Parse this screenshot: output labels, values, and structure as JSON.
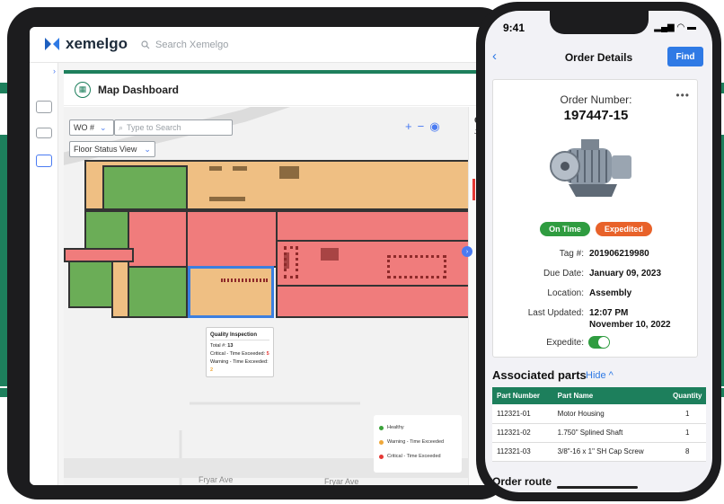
{
  "brand": {
    "name": "xemelgo",
    "green": "#1d7f5c",
    "blue": "#2f7ae5"
  },
  "tablet": {
    "search_placeholder": "Search Xemelgo",
    "dashboard_title": "Map Dashboard",
    "filter_select": "WO #",
    "map_search_placeholder": "Type to Search",
    "view_select": "Floor Status View",
    "zoom_in": "+",
    "zoom_out": "−",
    "right_panel_fragment": "C",
    "right_panel_fragment_2": "Jo",
    "popup": {
      "title": "Quality Inspection",
      "total_label": "Total #:",
      "total_value": "13",
      "critical_label": "Critical - Time Exceeded:",
      "critical_value": "5",
      "warning_label": "Warning - Time Exceeded:",
      "warning_value": "2"
    },
    "legend": [
      {
        "label": "Healthy",
        "color": "#3aa23a"
      },
      {
        "label": "Warning - Time Exceeded",
        "color": "#efa83a"
      },
      {
        "label": "Critical - Time Exceeded",
        "color": "#e53935"
      }
    ],
    "streets": [
      "Fryar Ave",
      "Fryar Ave"
    ]
  },
  "phone": {
    "time": "9:41",
    "nav_title": "Order Details",
    "find_label": "Find",
    "order_label": "Order Number:",
    "order_number": "197447-15",
    "badges": [
      "On Time",
      "Expedited"
    ],
    "fields": [
      {
        "key": "Tag #:",
        "value": "201906219980"
      },
      {
        "key": "Due Date:",
        "value": "January 09, 2023"
      },
      {
        "key": "Location:",
        "value": "Assembly"
      },
      {
        "key": "Last Updated:",
        "value": "12:07 PM",
        "value2": "November 10, 2022"
      },
      {
        "key": "Expedite:",
        "value": ""
      }
    ],
    "expedite_on": true,
    "parts_title": "Associated parts",
    "hide_label": "Hide ^",
    "parts_headers": [
      "Part Number",
      "Part Name",
      "Quantity"
    ],
    "parts": [
      {
        "number": "112321-01",
        "name": "Motor Housing",
        "qty": "1"
      },
      {
        "number": "112321-02",
        "name": "1.750\" Splined Shaft",
        "qty": "1"
      },
      {
        "number": "112321-03",
        "name": "3/8\"-16 x 1\" SH Cap Screw",
        "qty": "8"
      }
    ],
    "route_title": "Order route"
  }
}
